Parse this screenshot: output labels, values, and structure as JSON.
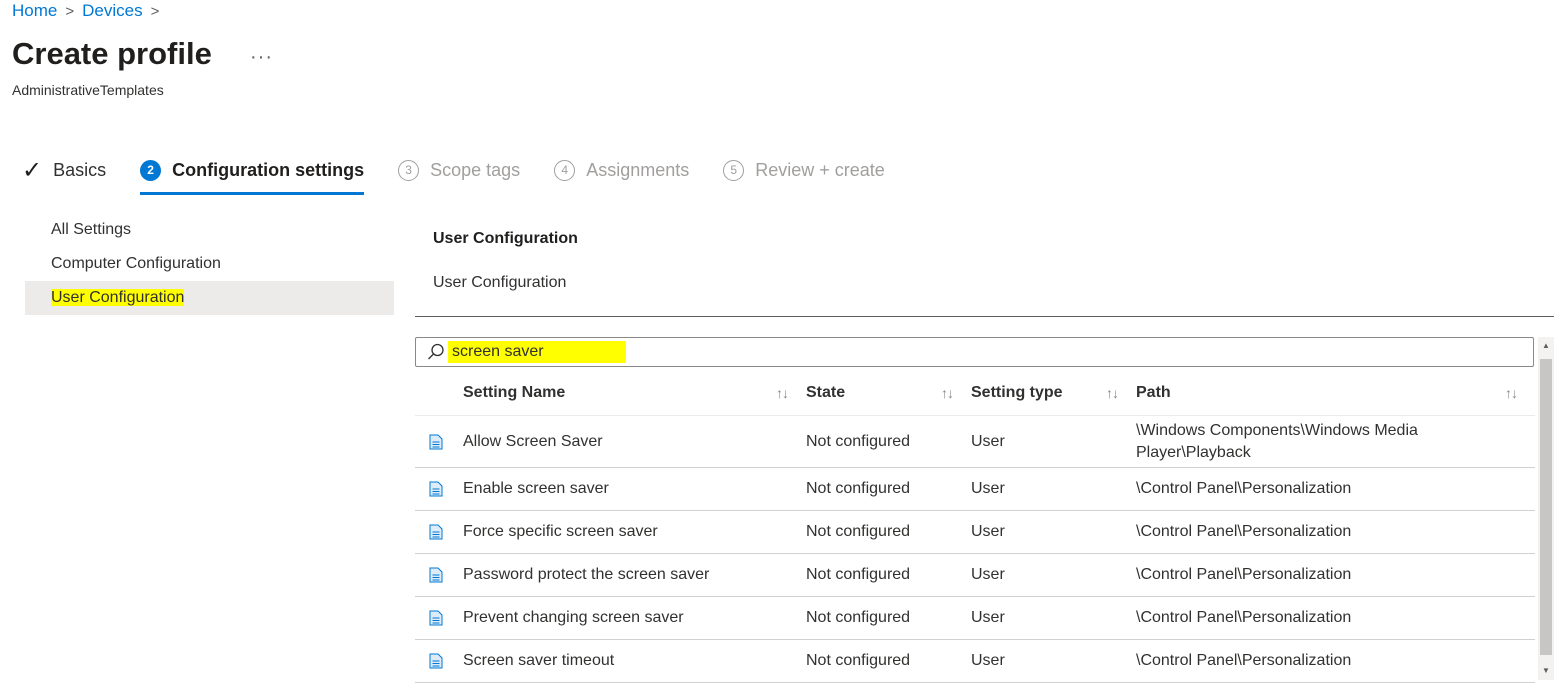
{
  "breadcrumb": {
    "home": "Home",
    "devices": "Devices",
    "sep": ">"
  },
  "page": {
    "title": "Create profile",
    "more": "···",
    "subtitle": "AdministrativeTemplates"
  },
  "steps": [
    {
      "label": "Basics",
      "state": "done",
      "marker": "✓"
    },
    {
      "label": "Configuration settings",
      "state": "active",
      "marker": "2"
    },
    {
      "label": "Scope tags",
      "state": "pending",
      "marker": "3"
    },
    {
      "label": "Assignments",
      "state": "pending",
      "marker": "4"
    },
    {
      "label": "Review + create",
      "state": "pending",
      "marker": "5"
    }
  ],
  "nav": {
    "items": [
      {
        "label": "All Settings"
      },
      {
        "label": "Computer Configuration"
      },
      {
        "label": "User Configuration",
        "selected": true
      }
    ]
  },
  "section": {
    "title": "User Configuration",
    "subtitle": "User Configuration"
  },
  "search": {
    "value": "screen saver",
    "highlight_color": "#ffff00"
  },
  "table": {
    "columns": [
      {
        "label": "Setting Name",
        "sort": "↑↓"
      },
      {
        "label": "State",
        "sort": "↑↓"
      },
      {
        "label": "Setting type",
        "sort": "↑↓"
      },
      {
        "label": "Path",
        "sort": "↑↓"
      }
    ],
    "rows": [
      {
        "name": "Allow Screen Saver",
        "state": "Not configured",
        "type": "User",
        "path": "\\Windows Components\\Windows Media Player\\Playback"
      },
      {
        "name": "Enable screen saver",
        "state": "Not configured",
        "type": "User",
        "path": "\\Control Panel\\Personalization"
      },
      {
        "name": "Force specific screen saver",
        "state": "Not configured",
        "type": "User",
        "path": "\\Control Panel\\Personalization"
      },
      {
        "name": "Password protect the screen saver",
        "state": "Not configured",
        "type": "User",
        "path": "\\Control Panel\\Personalization"
      },
      {
        "name": "Prevent changing screen saver",
        "state": "Not configured",
        "type": "User",
        "path": "\\Control Panel\\Personalization"
      },
      {
        "name": "Screen saver timeout",
        "state": "Not configured",
        "type": "User",
        "path": "\\Control Panel\\Personalization"
      }
    ]
  },
  "colors": {
    "accent": "#0078d4",
    "highlight": "#ffff00",
    "nav_selected": "#edebe9"
  },
  "icons": {
    "search": "search-icon",
    "row": "document-icon",
    "check": "checkmark-icon"
  }
}
